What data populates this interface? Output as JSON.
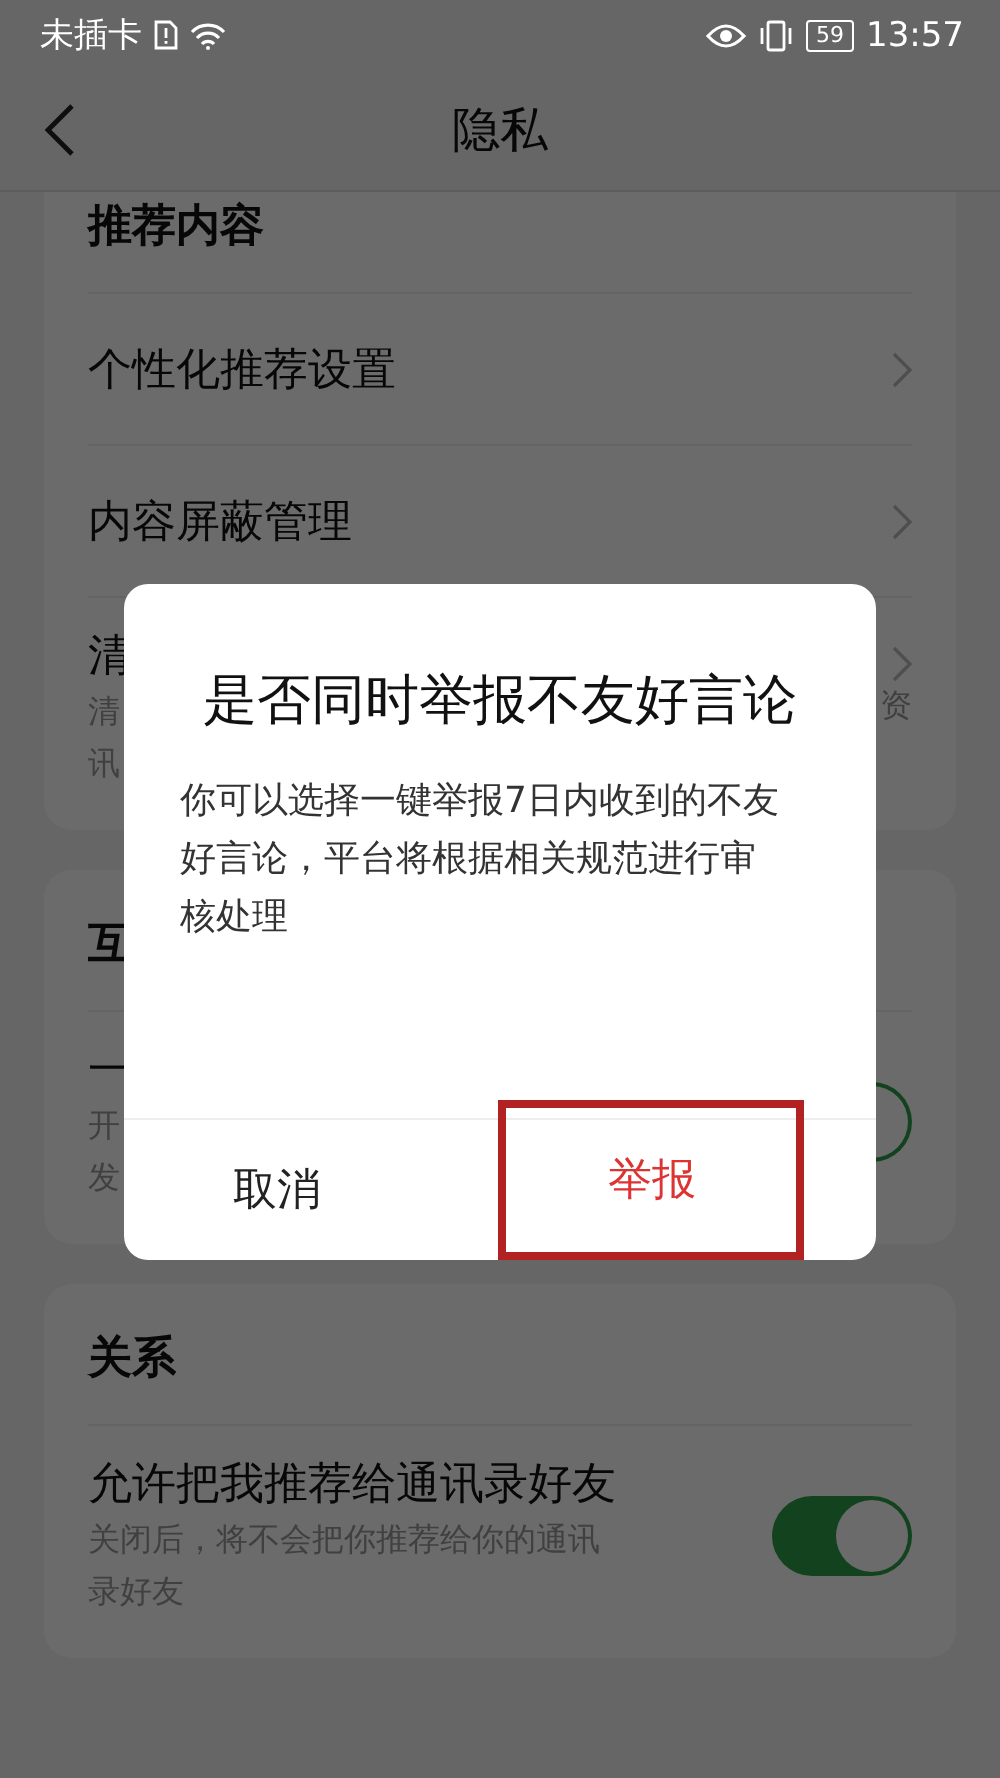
{
  "status_bar": {
    "carrier": "未插卡",
    "battery": "59",
    "time": "13:57"
  },
  "header": {
    "title": "隐私"
  },
  "sections": [
    {
      "title": "推荐内容",
      "items": [
        {
          "kind": "link",
          "title": "个性化推荐设置"
        },
        {
          "kind": "link",
          "title": "内容屏蔽管理"
        },
        {
          "kind": "link",
          "title": "清",
          "subtitle": [
            "清",
            "讯"
          ],
          "subtitle_tail": "资"
        }
      ]
    },
    {
      "title": "互",
      "items": [
        {
          "kind": "toggle",
          "title": "一",
          "subtitle": [
            "开",
            "发"
          ],
          "on": true
        }
      ]
    },
    {
      "title": "关系",
      "items": [
        {
          "kind": "toggle",
          "title": "允许把我推荐给通讯录好友",
          "subtitle": [
            "关闭后，将不会把你推荐给你的通讯",
            "录好友"
          ],
          "on": true
        }
      ]
    }
  ],
  "dialog": {
    "title": "是否同时举报不友好言论",
    "message": "你可以选择一键举报7日内收到的不友好言论，平台将根据相关规范进行审核处理",
    "buttons": [
      {
        "kind": "cancel",
        "label": "取消",
        "highlighted": false
      },
      {
        "kind": "confirm",
        "label": "举报",
        "highlighted": true
      }
    ]
  }
}
